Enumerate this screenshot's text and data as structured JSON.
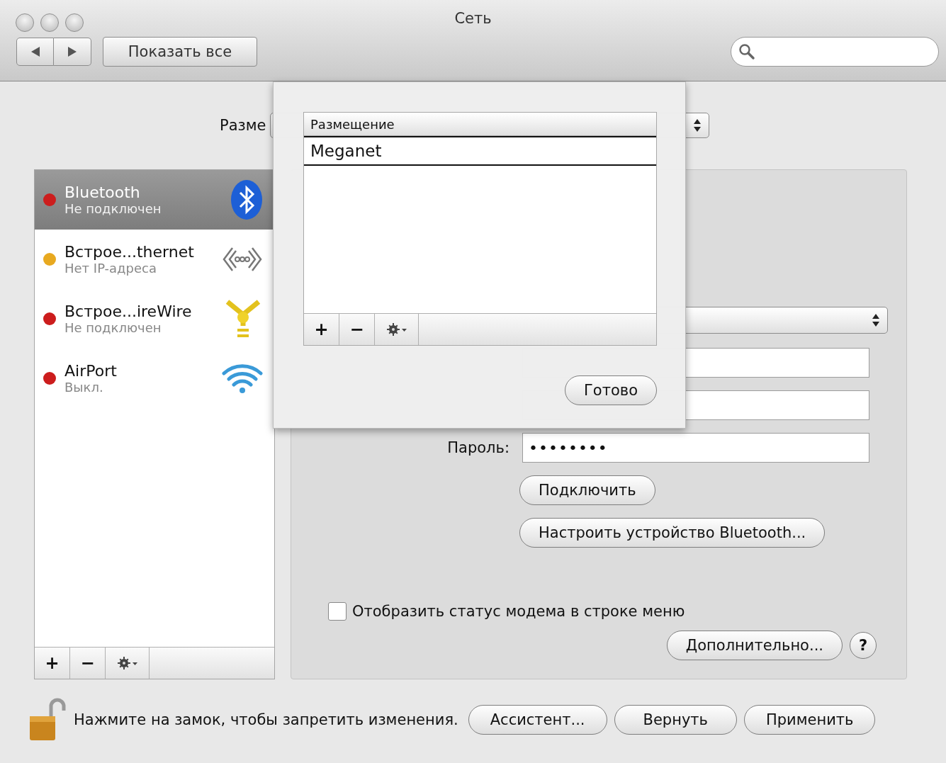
{
  "window": {
    "title": "Сеть"
  },
  "toolbar": {
    "show_all": "Показать все"
  },
  "location": {
    "label": "Разме"
  },
  "services": [
    {
      "name": "Bluetooth",
      "status": "Не подключен",
      "color": "#cc1d1d",
      "kind": "bluetooth",
      "selected": true
    },
    {
      "name": "Встрое...thernet",
      "status": "Нет IP-адреса",
      "color": "#e8a920",
      "kind": "ethernet",
      "selected": false
    },
    {
      "name": "Встрое...ireWire",
      "status": "Не подключен",
      "color": "#cc1d1d",
      "kind": "firewire",
      "selected": false
    },
    {
      "name": "AirPort",
      "status": "Выкл.",
      "color": "#cc1d1d",
      "kind": "wifi",
      "selected": false
    }
  ],
  "list_toolbar": {
    "add": "+",
    "remove": "−"
  },
  "panel": {
    "password": {
      "label": "Пароль:",
      "value": "••••••••"
    },
    "buttons": [
      "Подключить",
      "Настроить устройство Bluetooth..."
    ],
    "show_status": {
      "label": "Отобразить статус модема в строке меню",
      "checked": false
    },
    "advanced": "Дополнительно...",
    "help": "?"
  },
  "footer": {
    "lock_text": "Нажмите на замок, чтобы запретить изменения.",
    "buttons": [
      "Ассистент...",
      "Вернуть",
      "Применить"
    ]
  },
  "sheet": {
    "column": "Размещение",
    "rows": [
      {
        "name": "Meganet",
        "selected": true
      }
    ],
    "add": "+",
    "remove": "−",
    "done": "Готово"
  }
}
